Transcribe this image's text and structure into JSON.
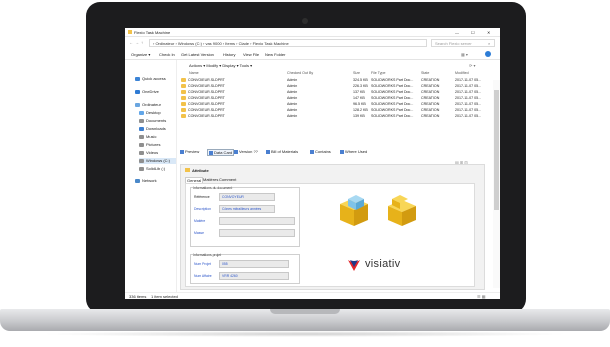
{
  "window": {
    "title": "Flexio Task Machine",
    "minimize": "—",
    "maximize": "☐",
    "close": "✕"
  },
  "address": {
    "path": "› Ordinateur › Windows (C:) › vas 9000 › Items › Clade › Flexio Task Machine",
    "search_placeholder": "Search Flexio server"
  },
  "ribbon": {
    "organize": "Organize ▾",
    "check_in": "Check In",
    "get_latest": "Get Latest Version",
    "history": "History",
    "view_file": "View File",
    "new_folder": "New Folder"
  },
  "nav": {
    "items": [
      {
        "label": "Quick access",
        "color": "#3c84d6"
      },
      {
        "label": "OneDrive",
        "color": "#2f7bd4"
      },
      {
        "label": "Ordinateur",
        "color": "#6aa6e0"
      },
      {
        "label": "Desktop",
        "color": "#62a6e8"
      },
      {
        "label": "Documents",
        "color": "#8f8f8f"
      },
      {
        "label": "Downloads",
        "color": "#3d7fd0"
      },
      {
        "label": "Music",
        "color": "#8f8f8f"
      },
      {
        "label": "Pictures",
        "color": "#8f8f8f"
      },
      {
        "label": "Videos",
        "color": "#8f8f8f"
      },
      {
        "label": "Windows (C:)",
        "color": "#8f8f8f"
      },
      {
        "label": "SolidLib (:)",
        "color": "#8f8f8f"
      },
      {
        "label": "Network",
        "color": "#4a88c9"
      }
    ]
  },
  "list": {
    "toolbar": "Actions ▾  Modify ▾  Display ▾  Tools ▾",
    "columns": [
      "Name",
      "Checked Out By",
      "Size",
      "File Type",
      "State",
      "Modified"
    ],
    "rows": [
      {
        "name": "CONVOIEUR.SLDPRT",
        "by": "Admin",
        "size": "324.5 KB",
        "type": "SOLIDWORKS Part Doc...",
        "state": "CREATION",
        "modified": "2017-11-07 05..."
      },
      {
        "name": "CONVOIEUR.SLDPRT",
        "by": "Admin",
        "size": "226.3 KB",
        "type": "SOLIDWORKS Part Doc...",
        "state": "CREATION",
        "modified": "2017-11-07 05..."
      },
      {
        "name": "CONVOIEUR.SLDPRT",
        "by": "Admin",
        "size": "137 KB",
        "type": "SOLIDWORKS Part Doc...",
        "state": "CREATION",
        "modified": "2017-11-07 05..."
      },
      {
        "name": "CONVOIEUR.SLDPRT",
        "by": "Admin",
        "size": "147 KB",
        "type": "SOLIDWORKS Part Doc...",
        "state": "CREATION",
        "modified": "2017-11-07 05..."
      },
      {
        "name": "CONVOIEUR.SLDPRT",
        "by": "Admin",
        "size": "96.5 KB",
        "type": "SOLIDWORKS Part Doc...",
        "state": "CREATION",
        "modified": "2017-11-07 05..."
      },
      {
        "name": "CONVOIEUR.SLDPRT",
        "by": "Admin",
        "size": "128.2 KB",
        "type": "SOLIDWORKS Part Doc...",
        "state": "CREATION",
        "modified": "2017-11-07 05..."
      },
      {
        "name": "CONVOIEUR.SLDPRT",
        "by": "Admin",
        "size": "139 KB",
        "type": "SOLIDWORKS Part Doc...",
        "state": "CREATION",
        "modified": "2017-11-07 05..."
      }
    ]
  },
  "view_tabs": [
    "Preview",
    "Data Card",
    "Version ??",
    "Bill of Materials",
    "Contains",
    "Where Used"
  ],
  "card": {
    "tab_label": "Attribute",
    "sub_tabs": [
      "General",
      "Matières",
      "Comment"
    ],
    "section1": "Informations du document",
    "fields1": [
      {
        "label": "Référence",
        "value": "CONVOYEUR"
      },
      {
        "label": "Description",
        "value": "Cônes mitrailleurs années"
      },
      {
        "label": "Matière",
        "value": ""
      },
      {
        "label": "Masse",
        "value": ""
      }
    ],
    "section2": "Informations projet",
    "fields2": [
      {
        "label": "Num Projet",
        "value": "055"
      },
      {
        "label": "Num Affaire",
        "value": "VRR 4260"
      }
    ],
    "logo_text": "visiativ",
    "accent": "#e2262a",
    "cube_color": "#f4c21b",
    "cube_blue": "#7fc3e8"
  },
  "status": {
    "items": "336 items",
    "selected": "1 item selected"
  }
}
